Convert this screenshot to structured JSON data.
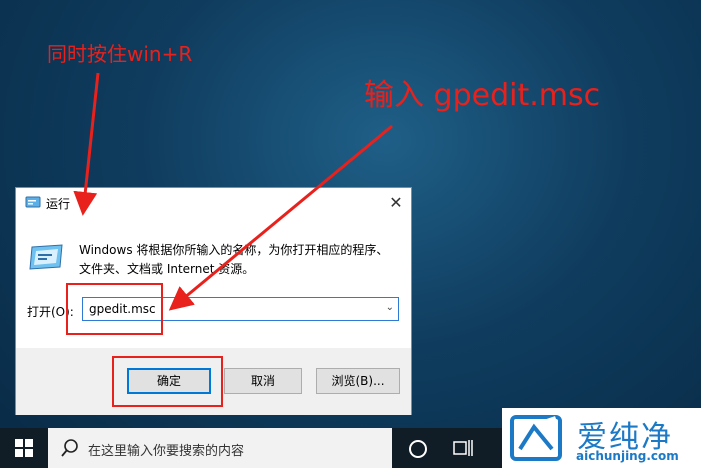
{
  "annotations": {
    "hint_keys": "同时按住win+R",
    "hint_type": "输入 gpedit.msc"
  },
  "dialog": {
    "title": "运行",
    "close_glyph": "✕",
    "description": "Windows 将根据你所输入的名称，为你打开相应的程序、文件夹、文档或 Internet 资源。",
    "open_label": "打开(O):",
    "input_value": "gpedit.msc",
    "buttons": {
      "ok": "确定",
      "cancel": "取消",
      "browse": "浏览(B)..."
    }
  },
  "taskbar": {
    "search_placeholder": "在这里输入你要搜索的内容"
  },
  "watermark": {
    "title": "爱纯净",
    "url": "aichunjing.com"
  },
  "colors": {
    "annotation_red": "#e8211c",
    "accent_blue": "#0078d7",
    "watermark_blue": "#1c79c6"
  }
}
